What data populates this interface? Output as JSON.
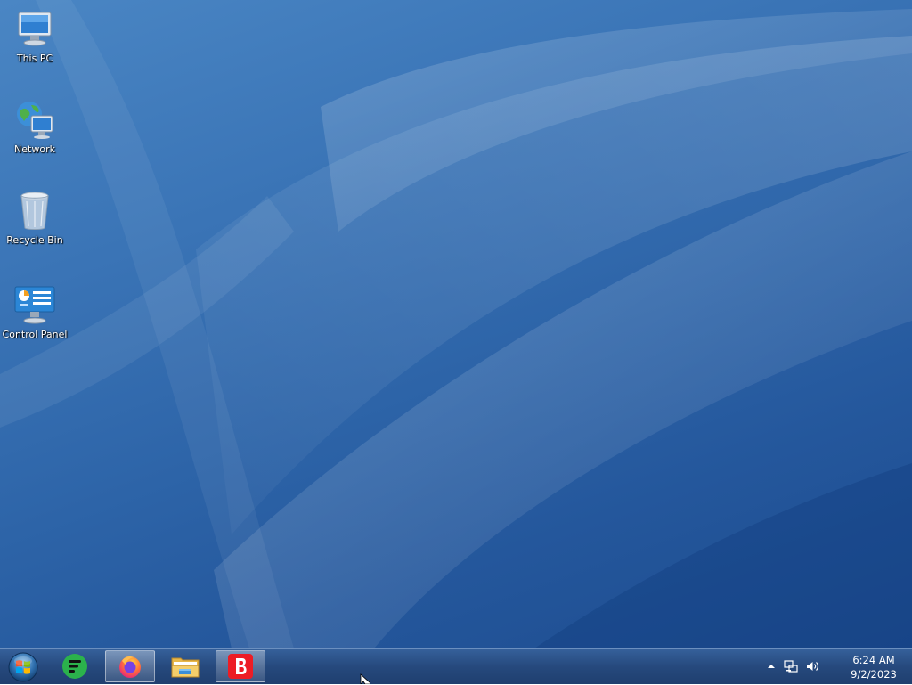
{
  "desktop": {
    "icons": [
      {
        "label": "This PC",
        "icon": "computer-icon"
      },
      {
        "label": "Network",
        "icon": "network-icon"
      },
      {
        "label": "Recycle Bin",
        "icon": "recycle-bin-icon"
      },
      {
        "label": "Control Panel",
        "icon": "control-panel-icon"
      }
    ]
  },
  "taskbar": {
    "start": {
      "icon": "windows-start-icon"
    },
    "pinned": [
      {
        "icon": "feedly-app-icon",
        "active": false
      },
      {
        "icon": "firefox-icon",
        "active": true
      },
      {
        "icon": "file-explorer-icon",
        "active": false
      },
      {
        "icon": "bitdefender-icon",
        "active": true
      }
    ],
    "tray": {
      "icons": [
        "show-hidden-icons-arrow",
        "network-status-icon",
        "volume-icon"
      ],
      "time": "6:24 AM",
      "date": "9/2/2023"
    }
  },
  "colors": {
    "desktop_background": "#2d64a8",
    "taskbar": "#26497d",
    "firefox_orange": "#ff7139",
    "feedly_green": "#2bb24c",
    "bitdefender_red": "#ed1c24"
  }
}
